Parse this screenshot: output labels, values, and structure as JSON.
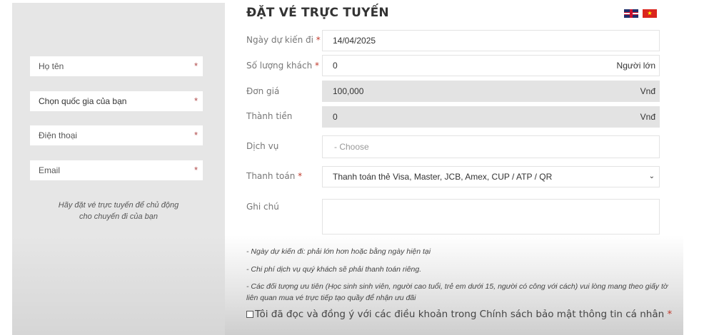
{
  "left": {
    "fields": [
      {
        "placeholder": "Họ tên",
        "required": "*"
      },
      {
        "value": "Chọn quốc gia của bạn",
        "required": "*"
      },
      {
        "placeholder": "Điện thoại",
        "required": "*"
      },
      {
        "placeholder": "Email",
        "required": "*"
      }
    ],
    "note_line1": "Hãy đặt vé trực tuyến để chủ động",
    "note_line2": "cho chuyến đi của bạn"
  },
  "form": {
    "title": "ĐẶT VÉ TRỰC TUYẾN",
    "languages": [
      "english-flag-icon",
      "vietnam-flag-icon"
    ],
    "rows": [
      {
        "label": "Ngày dự kiến đi",
        "required": "*",
        "value": "14/04/2025"
      },
      {
        "label": "Số lượng khách",
        "required": "*",
        "value": "0",
        "unit": "Người lớn"
      },
      {
        "label": "Đơn giá",
        "value": "100,000",
        "unit": "Vnđ"
      },
      {
        "label": "Thành tiền",
        "value": "0",
        "unit": "Vnđ"
      },
      {
        "label": "Dịch vụ",
        "placeholder": "- Choose"
      },
      {
        "label": "Thanh toán",
        "required": "*",
        "value": "Thanh toán thẻ Visa, Master, JCB, Amex, CUP / ATP / QR"
      },
      {
        "label": "Ghi chú",
        "value": ""
      }
    ],
    "notes": [
      "- Ngày dự kiến đi: phải lớn hơn hoặc bằng ngày hiện tại",
      "- Chi phí dịch vụ quý khách sẽ phải thanh toán riêng.",
      "- Các đối tượng ưu tiên (Học sinh sinh viên, người cao tuổi, trẻ em dưới 15, người có công với cách) vui lòng mang theo giấy tờ liên quan mua vé trực tiếp tạo quầy để nhận ưu đãi"
    ],
    "agree": "Tôi đã đọc và đồng ý với các điều khoản trong Chính sách bảo mật thông tin cá nhân",
    "agree_required": "*"
  },
  "colors": {
    "required": "#c0392b",
    "panel": "#e6e6e6",
    "readonly": "#e3e3e3"
  }
}
